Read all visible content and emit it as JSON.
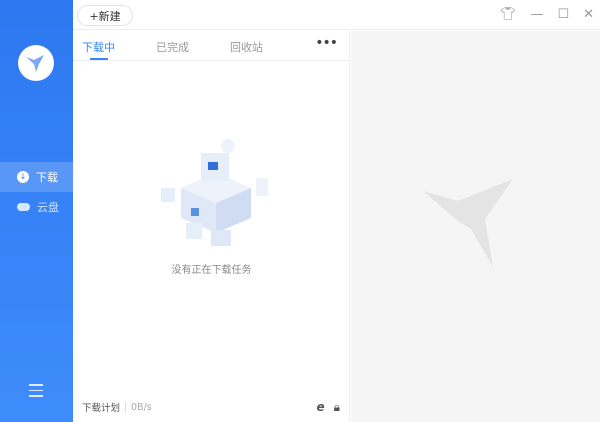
{
  "toolbar": {
    "new_label": "+新建"
  },
  "sidebar": {
    "items": [
      {
        "label": "下载",
        "icon": "download-icon"
      },
      {
        "label": "云盘",
        "icon": "cloud-icon"
      }
    ]
  },
  "tabs": [
    {
      "label": "下载中"
    },
    {
      "label": "已完成"
    },
    {
      "label": "回收站"
    }
  ],
  "more_label": "•••",
  "empty_message": "没有正在下载任务",
  "footer": {
    "plan_label": "下载计划",
    "speed": "0B/s"
  },
  "colors": {
    "accent": "#3a86f4",
    "sidebar": "#2f7ef4"
  }
}
